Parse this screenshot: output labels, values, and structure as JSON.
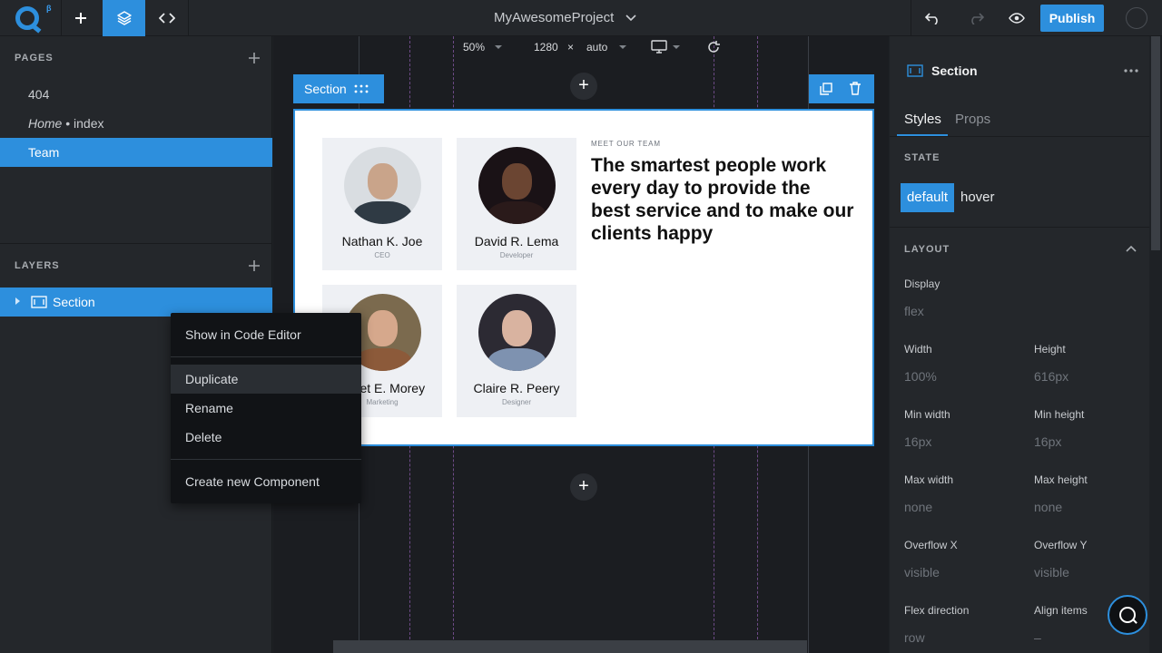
{
  "topbar": {
    "project_name": "MyAwesomeProject",
    "publish_label": "Publish",
    "beta_mark": "β"
  },
  "pages": {
    "heading": "PAGES",
    "items": [
      {
        "label": "404"
      },
      {
        "label_italic": "Home",
        "label_suffix": " • index"
      },
      {
        "label": "Team"
      }
    ]
  },
  "layers": {
    "heading": "LAYERS",
    "items": [
      {
        "label": "Section"
      }
    ]
  },
  "viewbar": {
    "zoom": "50%",
    "width": "1280",
    "times": "×",
    "height": "auto"
  },
  "canvas": {
    "section_label": "Section",
    "team": [
      {
        "name": "Nathan K. Joe",
        "role": "CEO"
      },
      {
        "name": "David R. Lema",
        "role": "Developer"
      },
      {
        "name": "Janet E. Morey",
        "role": "Marketing"
      },
      {
        "name": "Claire R. Peery",
        "role": "Designer"
      }
    ],
    "eyebrow": "MEET OUR TEAM",
    "headline": "The smartest people work every day to provide the best service and to make our clients happy"
  },
  "context_menu": {
    "show_in_code": "Show in Code Editor",
    "duplicate": "Duplicate",
    "rename": "Rename",
    "delete": "Delete",
    "create_component": "Create new Component"
  },
  "inspector": {
    "title": "Section",
    "tabs": {
      "styles": "Styles",
      "props": "Props"
    },
    "state_heading": "STATE",
    "state_default": "default",
    "state_hover": "hover",
    "layout_heading": "LAYOUT",
    "display_label": "Display",
    "display_value": "flex",
    "width_label": "Width",
    "width_value": "100%",
    "height_label": "Height",
    "height_value": "616px",
    "min_width_label": "Min width",
    "min_width_value": "16px",
    "min_height_label": "Min height",
    "min_height_value": "16px",
    "max_width_label": "Max width",
    "max_width_value": "none",
    "max_height_label": "Max height",
    "max_height_value": "none",
    "overflow_x_label": "Overflow X",
    "overflow_x_value": "visible",
    "overflow_y_label": "Overflow Y",
    "overflow_y_value": "visible",
    "flex_direction_label": "Flex direction",
    "flex_direction_value": "row",
    "align_items_label": "Align items",
    "align_items_value": "–"
  },
  "colors": {
    "accent": "#2d8fdd",
    "panel": "#24272b",
    "canvas": "#1b1d21"
  }
}
